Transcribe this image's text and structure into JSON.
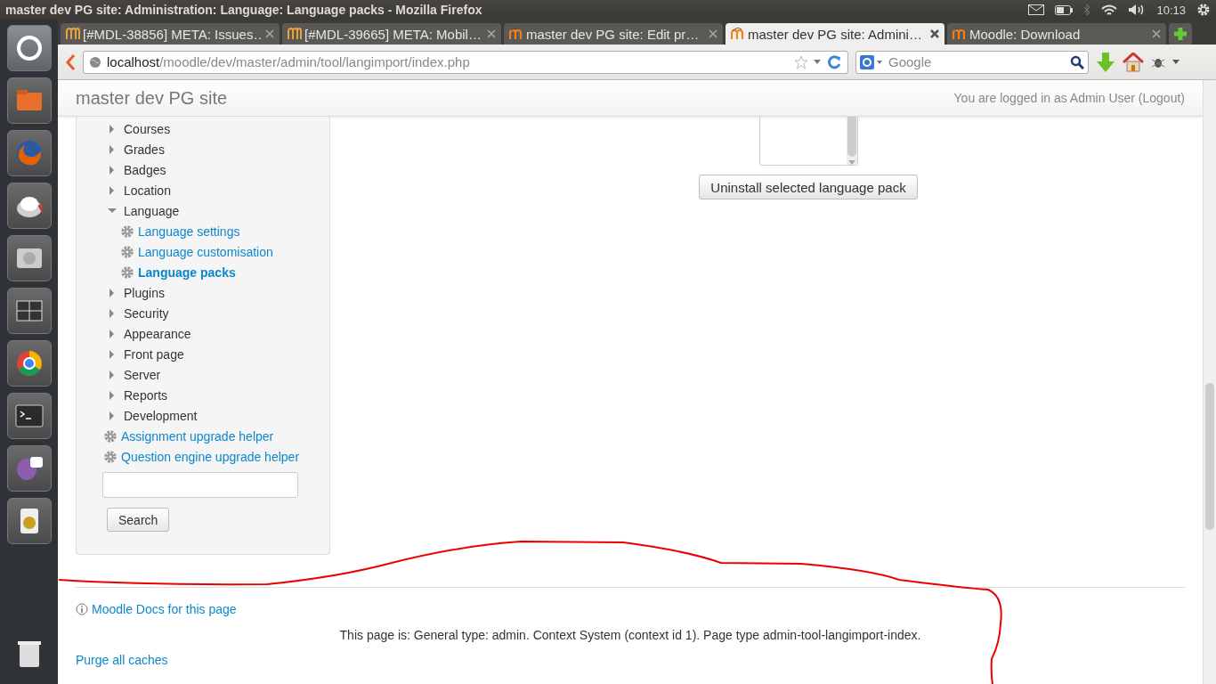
{
  "window": {
    "title": "master dev PG site: Administration: Language: Language packs - Mozilla Firefox"
  },
  "clock": "10:13",
  "tabs": [
    {
      "label": "[#MDL-38856] META: Issues…",
      "kind": "tracker",
      "selected": false
    },
    {
      "label": "[#MDL-39665] META: Mobil…",
      "kind": "tracker",
      "selected": false
    },
    {
      "label": "master dev PG site: Edit pr…",
      "kind": "moodle",
      "selected": false
    },
    {
      "label": "master dev PG site: Admini…",
      "kind": "moodle",
      "selected": true
    },
    {
      "label": "Moodle: Download",
      "kind": "moodle",
      "selected": false
    }
  ],
  "address_bar": {
    "host": "localhost",
    "path": "/moodle/dev/master/admin/tool/langimport/index.php"
  },
  "search_field": {
    "placeholder": "Google"
  },
  "page": {
    "site_name": "master dev PG site",
    "login_text": "You are logged in as Admin User",
    "logout_link": "(Logout)",
    "nav_tree": [
      {
        "kind": "branch",
        "label": "Courses",
        "expanded": false,
        "selected": false
      },
      {
        "kind": "branch",
        "label": "Grades",
        "expanded": false,
        "selected": false
      },
      {
        "kind": "branch",
        "label": "Badges",
        "expanded": false,
        "selected": false
      },
      {
        "kind": "branch",
        "label": "Location",
        "expanded": false,
        "selected": false
      },
      {
        "kind": "branch",
        "label": "Language",
        "expanded": true,
        "selected": false,
        "children": [
          {
            "kind": "setting",
            "label": "Language settings",
            "selected": false
          },
          {
            "kind": "setting",
            "label": "Language customisation",
            "selected": false
          },
          {
            "kind": "setting",
            "label": "Language packs",
            "selected": true
          }
        ]
      },
      {
        "kind": "branch",
        "label": "Plugins",
        "expanded": false,
        "selected": false
      },
      {
        "kind": "branch",
        "label": "Security",
        "expanded": false,
        "selected": false
      },
      {
        "kind": "branch",
        "label": "Appearance",
        "expanded": false,
        "selected": false
      },
      {
        "kind": "branch",
        "label": "Front page",
        "expanded": false,
        "selected": false
      },
      {
        "kind": "branch",
        "label": "Server",
        "expanded": false,
        "selected": false
      },
      {
        "kind": "branch",
        "label": "Reports",
        "expanded": false,
        "selected": false
      },
      {
        "kind": "branch",
        "label": "Development",
        "expanded": false,
        "selected": false
      },
      {
        "kind": "setting",
        "label": "Assignment upgrade helper",
        "selected": false
      },
      {
        "kind": "setting",
        "label": "Question engine upgrade helper",
        "selected": false
      }
    ],
    "search_button": "Search",
    "uninstall_button": "Uninstall selected language pack",
    "footer": {
      "docs_link": "Moodle Docs for this page",
      "page_info": "This page is: General type: admin. Context System (context id 1). Page type admin-tool-langimport-index.",
      "purge_link": "Purge all caches"
    }
  }
}
